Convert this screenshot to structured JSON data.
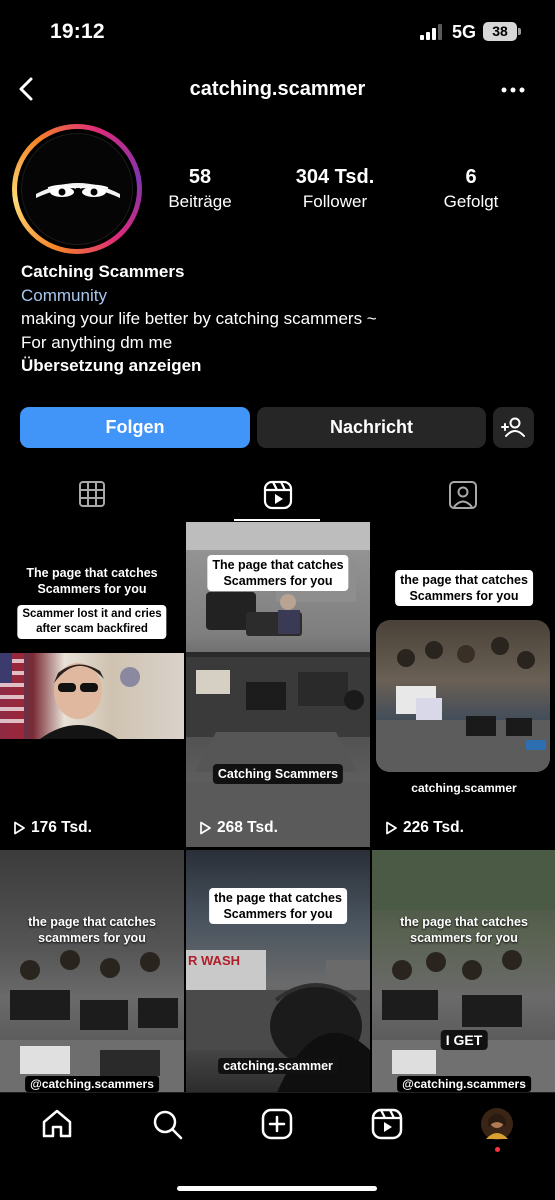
{
  "status_bar": {
    "time": "19:12",
    "network": "5G",
    "battery": "38"
  },
  "nav": {
    "username": "catching.scammer"
  },
  "profile": {
    "stats": [
      {
        "value": "58",
        "label": "Beiträge"
      },
      {
        "value": "304 Tsd.",
        "label": "Follower"
      },
      {
        "value": "6",
        "label": "Gefolgt"
      }
    ],
    "display_name": "Catching Scammers",
    "category": "Community",
    "bio_lines": [
      "making your life better by catching scammers ~",
      "For anything dm me"
    ],
    "translate_link": "Übersetzung anzeigen"
  },
  "actions": {
    "follow": "Folgen",
    "message": "Nachricht"
  },
  "tabs": [
    {
      "icon": "grid-icon"
    },
    {
      "icon": "reels-icon",
      "active": true
    },
    {
      "icon": "tagged-icon"
    }
  ],
  "reels": [
    {
      "caption_top": "The page that catches\nScammers for you",
      "caption_sub": "Scammer lost it and cries\nafter scam backfired",
      "views": "176 Tsd."
    },
    {
      "caption_top": "The page that catches\nScammers for you",
      "caption_bottom": "Catching Scammers",
      "views": "268 Tsd."
    },
    {
      "caption_top": "the page that catches\nScammers for you",
      "caption_bottom": "catching.scammer",
      "views": "226 Tsd."
    },
    {
      "caption_top": "the page that catches\nscammers for you",
      "caption_bottom": "@catching.scammers"
    },
    {
      "caption_top": "the page that catches\nScammers for you",
      "caption_bottom": "catching.scammer"
    },
    {
      "caption_top": "the page that catches\nscammers for you",
      "caption_mid": "I GET",
      "caption_bottom": "@catching.scammers"
    }
  ],
  "bottom_nav": [
    {
      "icon": "home-icon"
    },
    {
      "icon": "search-icon"
    },
    {
      "icon": "create-icon"
    },
    {
      "icon": "reels-icon"
    },
    {
      "icon": "profile-avatar"
    }
  ],
  "colors": {
    "accent": "#4194f8",
    "secondary_button": "#262626",
    "category_link": "#a8c7ee"
  }
}
